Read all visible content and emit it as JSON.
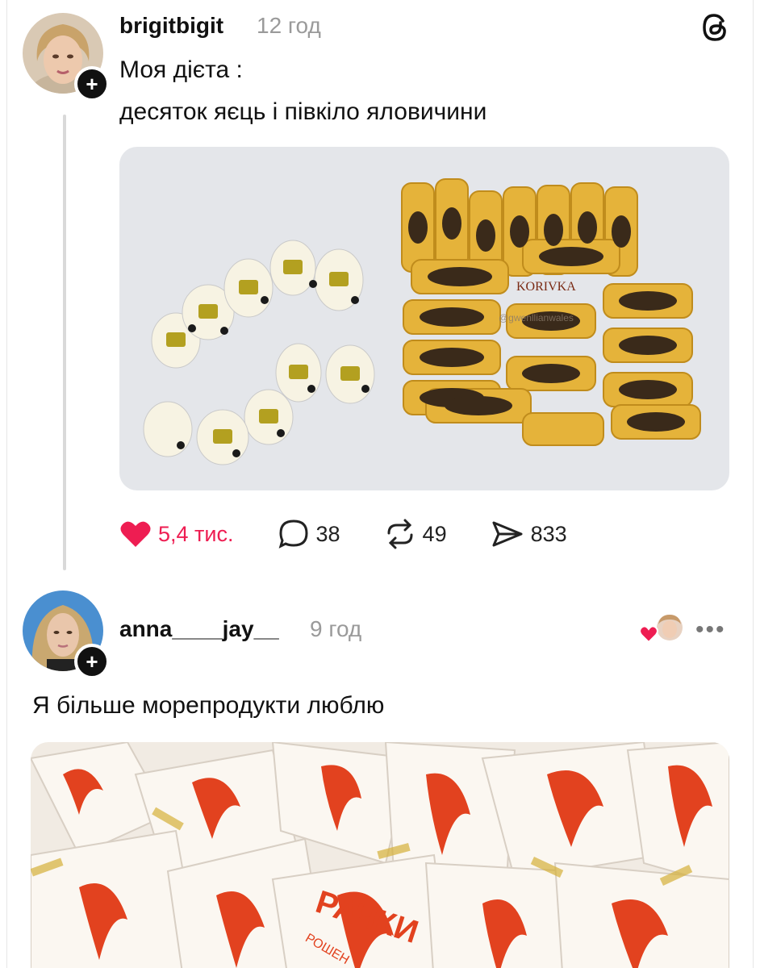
{
  "post1": {
    "username": "brigitbigit",
    "time": "12 год",
    "text_line1": "Моя дієта :",
    "text_line2": "десяток яєць і півкіло яловичини",
    "image_watermark": "@gwenllianwales",
    "candy_label": "KORIVKA",
    "likes": "5,4 тис.",
    "comments": "38",
    "reposts": "49",
    "shares": "833"
  },
  "post2": {
    "username": "anna____jay__",
    "time": "9 год",
    "text": "Я більше морепродукти люблю",
    "candy_label": "РАЧКИ",
    "candy_brand": "РОШЕН"
  },
  "icons": {
    "threads": "threads-logo-icon",
    "plus": "follow-plus-icon",
    "heart": "heart-icon",
    "comment": "comment-icon",
    "repost": "repost-icon",
    "share": "share-icon",
    "more": "more-icon"
  },
  "colors": {
    "like": "#ee1d52",
    "muted": "#9a9a9a",
    "text": "#111111"
  }
}
